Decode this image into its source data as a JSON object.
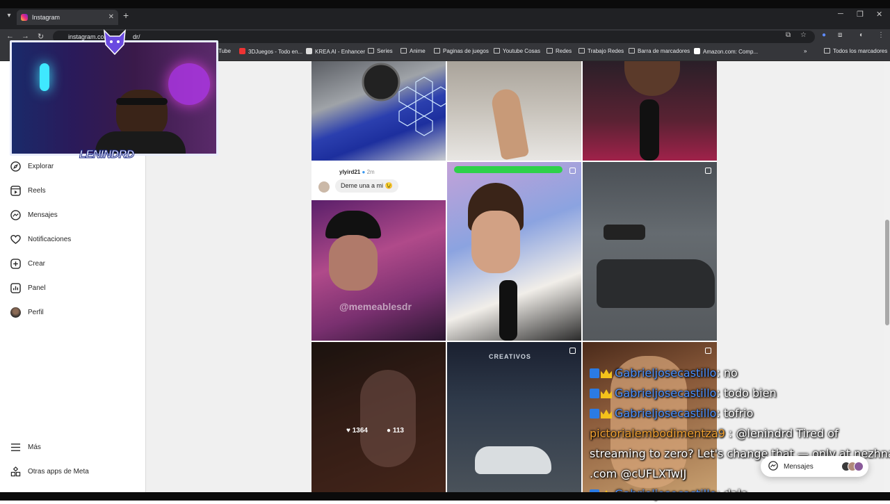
{
  "browser": {
    "tab_title": "Instagram",
    "tab_close": "✕",
    "new_tab": "+",
    "url_prefix": "instagram.com",
    "url_suffix": "dr/",
    "bookmarks": [
      {
        "label": "Tube",
        "icon": "youtube-icon"
      },
      {
        "label": "3DJuegos - Todo en...",
        "icon": "3djuegos-icon"
      },
      {
        "label": "KREA AI - Enhancer",
        "icon": "krea-icon"
      },
      {
        "label": "Series",
        "icon": "folder-icon"
      },
      {
        "label": "Anime",
        "icon": "folder-icon"
      },
      {
        "label": "Paginas de juegos",
        "icon": "folder-icon"
      },
      {
        "label": "Youtube Cosas",
        "icon": "folder-icon"
      },
      {
        "label": "Redes",
        "icon": "folder-icon"
      },
      {
        "label": "Trabajo Redes",
        "icon": "folder-icon"
      },
      {
        "label": "Barra de marcadores",
        "icon": "folder-icon"
      },
      {
        "label": "Amazon.com: Comp...",
        "icon": "amazon-icon"
      }
    ],
    "all_bookmarks": "Todos los marcadores"
  },
  "sidebar": {
    "items": [
      {
        "label": "Explorar",
        "icon": "compass-icon"
      },
      {
        "label": "Reels",
        "icon": "reels-icon"
      },
      {
        "label": "Mensajes",
        "icon": "messenger-icon"
      },
      {
        "label": "Notificaciones",
        "icon": "heart-icon"
      },
      {
        "label": "Crear",
        "icon": "plus-square-icon"
      },
      {
        "label": "Panel",
        "icon": "chart-icon"
      },
      {
        "label": "Perfil",
        "icon": "avatar-icon"
      }
    ],
    "more": "Más",
    "meta_apps": "Otras apps de Meta"
  },
  "posts": {
    "comment_user": "ylyird21",
    "comment_time": "2m",
    "comment_text": "Deme una a mi 😉",
    "watermark": "@memeablesdr",
    "likes": "1364",
    "comments": "113",
    "game_label": "CREATIVOS"
  },
  "webcam": {
    "name": "LENINDRD"
  },
  "chat": [
    {
      "user": "Gabrieljosecastillo",
      "text": ": no",
      "badged": true
    },
    {
      "user": "Gabrieljosecastillo",
      "text": ": todo bien",
      "badged": true
    },
    {
      "user": "Gabrieljosecastillo",
      "text": ": tofrio",
      "badged": true
    },
    {
      "user": "pictorialembodimentza9",
      "text": " : @lenindrd Tired of",
      "badged": false
    },
    {
      "user": "",
      "text": "streaming to zero? Let's change that — only at nezhna",
      "badged": false
    },
    {
      "user": "",
      "text": ".com @cUFLXTwIJ",
      "badged": false
    },
    {
      "user": "Gabrieljosecastillo",
      "text": ": dale",
      "badged": true
    }
  ],
  "messages_pill": {
    "label": "Mensajes"
  },
  "colors": {
    "ig_border": "#dbdbdb",
    "chat_user": "#4a90ff",
    "chat_user_alt": "#f0a030"
  }
}
